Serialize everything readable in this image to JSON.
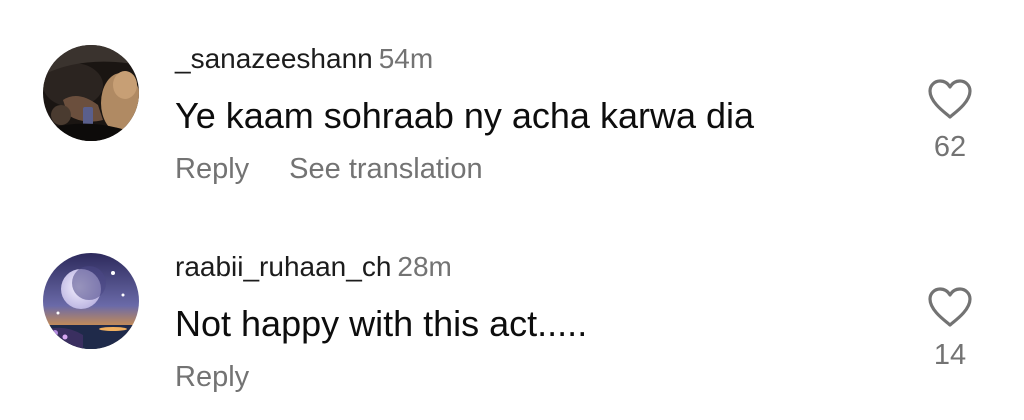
{
  "comments": [
    {
      "username": "_sanazeeshann",
      "time": "54m",
      "text": "Ye kaam sohraab ny acha karwa dia",
      "reply_label": "Reply",
      "translate_label": "See translation",
      "like_count": "62",
      "avatar": "avatar-car-interior",
      "like_icon": "heart-outline-icon"
    },
    {
      "username": "raabii_ruhaan_ch",
      "time": "28m",
      "text": "Not happy with this act.....",
      "reply_label": "Reply",
      "like_count": "14",
      "avatar": "avatar-moon-night",
      "like_icon": "heart-outline-icon"
    }
  ],
  "colors": {
    "secondary_text": "#737373",
    "primary_text": "#0d0d0d",
    "background": "#ffffff"
  }
}
